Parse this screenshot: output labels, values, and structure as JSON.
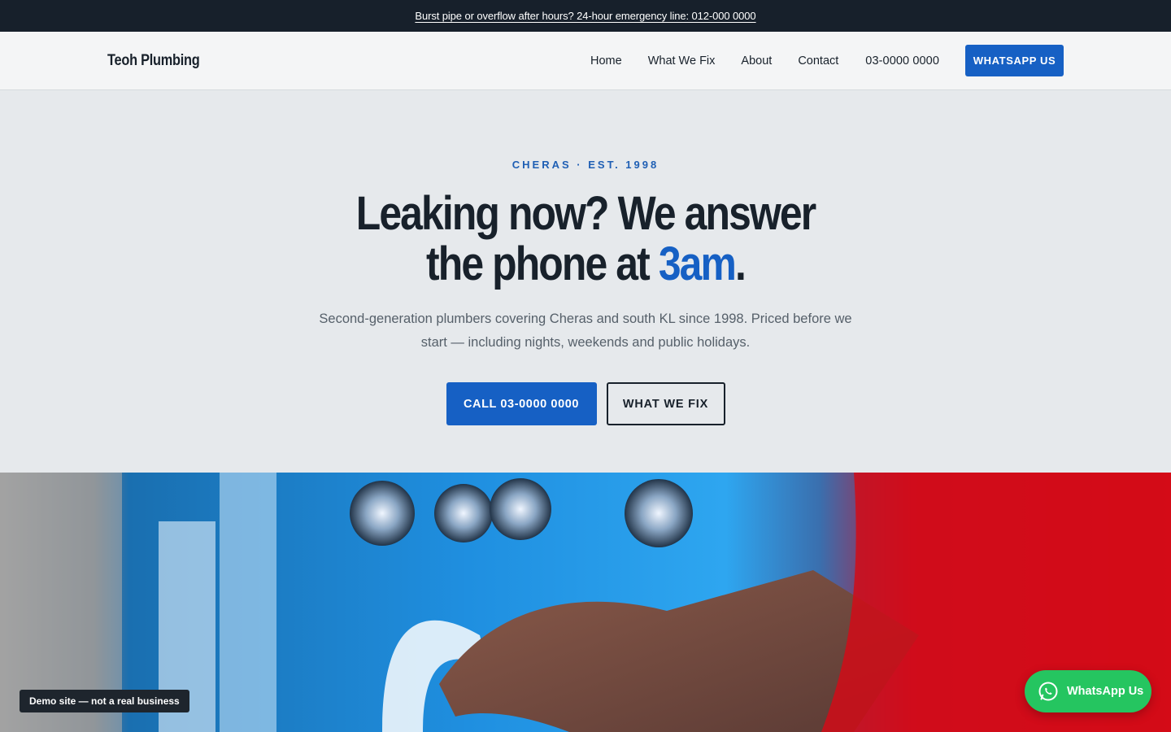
{
  "announcement": {
    "text": "Burst pipe or overflow after hours? 24-hour emergency line: 012-000 0000"
  },
  "nav": {
    "brand": "Teoh Plumbing",
    "links": [
      "Home",
      "What We Fix",
      "About",
      "Contact"
    ],
    "phone": "03-0000 0000",
    "cta": "WHATSAPP US"
  },
  "hero": {
    "eyebrow": "CHERAS · EST. 1998",
    "headline_line1": "Leaking now? We answer",
    "headline_line2_prefix": "the phone at ",
    "headline_accent": "3am",
    "headline_suffix": ".",
    "subtext": "Second-generation plumbers covering Cheras and south KL since 1998. Priced before we start — including nights, weekends and public holidays.",
    "primary_button": "CALL 03-0000 0000",
    "secondary_button": "WHAT WE FIX"
  },
  "badge": {
    "text": "Demo site — not a real business"
  },
  "floating_whatsapp": {
    "label": "WhatsApp Us",
    "icon": "whatsapp-icon"
  },
  "colors": {
    "accent": "#1660c4",
    "dark": "#17202b",
    "whatsapp": "#25c560"
  }
}
